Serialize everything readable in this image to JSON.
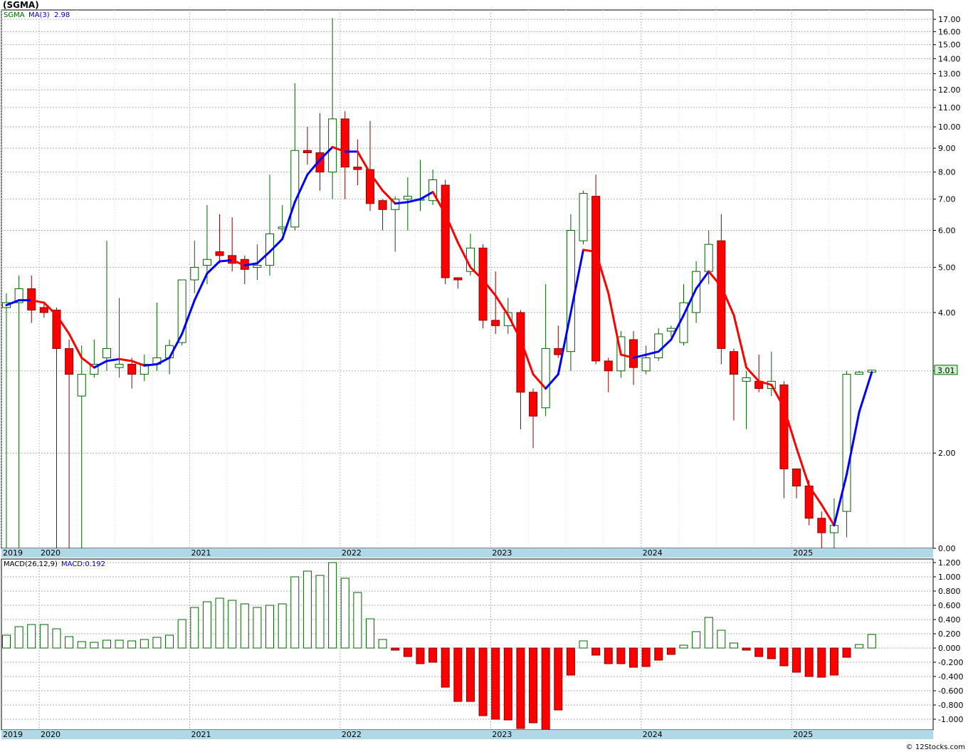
{
  "header": {
    "title": "(SGMA)"
  },
  "footer": {
    "credit": "© 12Stocks.com"
  },
  "colors": {
    "up": "#006400",
    "down": "#ff0000",
    "ma_up": "#0000ff",
    "ma_down": "#ff0000",
    "grid": "#b0b0b0",
    "year_band": "#b0d8e6",
    "hist_up": "#006400",
    "hist_down": "#ff0000",
    "macd_text": "#0000cc",
    "sym_text": "#006400"
  },
  "chart_data": [
    {
      "type": "candlestick",
      "legend": {
        "symbol": "SGMA",
        "ma_label": "MA(3)",
        "ma_value": "2.98"
      },
      "last_price_label": "3.01",
      "scale": "log",
      "ylim": [
        1.25,
        17.8
      ],
      "y_ticks": [
        "17.00",
        "16.00",
        "15.00",
        "14.00",
        "13.00",
        "12.00",
        "11.00",
        "10.00",
        "9.00",
        "8.00",
        "7.00",
        "6.00",
        "5.00",
        "4.00",
        "3.00",
        "2.00",
        "0.00"
      ],
      "year_labels": [
        {
          "label": "2019",
          "index": -0.3
        },
        {
          "label": "2020",
          "index": 3.0
        },
        {
          "label": "2021",
          "index": 15.0
        },
        {
          "label": "2022",
          "index": 27.0
        },
        {
          "label": "2023",
          "index": 39.0
        },
        {
          "label": "2024",
          "index": 51.0
        },
        {
          "label": "2025",
          "index": 63.0
        }
      ],
      "candles": [
        {
          "o": 4.1,
          "h": 4.4,
          "l": 1.25,
          "c": 4.2
        },
        {
          "o": 4.2,
          "h": 4.8,
          "l": 1.25,
          "c": 4.5
        },
        {
          "o": 4.5,
          "h": 4.8,
          "l": 3.8,
          "c": 4.05
        },
        {
          "o": 4.1,
          "h": 4.2,
          "l": 3.9,
          "c": 4.0
        },
        {
          "o": 4.05,
          "h": 4.1,
          "l": 1.25,
          "c": 3.35
        },
        {
          "o": 3.35,
          "h": 3.5,
          "l": 1.25,
          "c": 2.95
        },
        {
          "o": 2.65,
          "h": 3.4,
          "l": 1.25,
          "c": 2.95
        },
        {
          "o": 2.95,
          "h": 3.5,
          "l": 2.9,
          "c": 3.1
        },
        {
          "o": 3.2,
          "h": 5.7,
          "l": 3.0,
          "c": 3.35
        },
        {
          "o": 3.05,
          "h": 4.3,
          "l": 2.9,
          "c": 3.1
        },
        {
          "o": 3.1,
          "h": 3.2,
          "l": 2.75,
          "c": 2.95
        },
        {
          "o": 2.95,
          "h": 3.25,
          "l": 2.85,
          "c": 3.1
        },
        {
          "o": 3.1,
          "h": 4.2,
          "l": 3.0,
          "c": 3.2
        },
        {
          "o": 3.2,
          "h": 3.5,
          "l": 2.95,
          "c": 3.4
        },
        {
          "o": 3.45,
          "h": 4.7,
          "l": 3.4,
          "c": 4.7
        },
        {
          "o": 4.7,
          "h": 5.7,
          "l": 4.4,
          "c": 5.0
        },
        {
          "o": 5.05,
          "h": 6.8,
          "l": 4.6,
          "c": 5.2
        },
        {
          "o": 5.4,
          "h": 6.5,
          "l": 5.1,
          "c": 5.3
        },
        {
          "o": 5.3,
          "h": 6.4,
          "l": 4.9,
          "c": 5.1
        },
        {
          "o": 5.2,
          "h": 5.3,
          "l": 4.6,
          "c": 4.95
        },
        {
          "o": 5.0,
          "h": 5.6,
          "l": 4.7,
          "c": 5.05
        },
        {
          "o": 5.05,
          "h": 7.9,
          "l": 4.8,
          "c": 5.9
        },
        {
          "o": 6.05,
          "h": 6.8,
          "l": 5.9,
          "c": 6.1
        },
        {
          "o": 6.1,
          "h": 12.4,
          "l": 6.0,
          "c": 8.9
        },
        {
          "o": 8.9,
          "h": 10.0,
          "l": 8.3,
          "c": 8.8
        },
        {
          "o": 8.8,
          "h": 10.7,
          "l": 7.3,
          "c": 8.0
        },
        {
          "o": 8.0,
          "h": 17.1,
          "l": 7.0,
          "c": 10.4
        },
        {
          "o": 10.4,
          "h": 10.8,
          "l": 7.0,
          "c": 8.2
        },
        {
          "o": 8.2,
          "h": 9.4,
          "l": 7.5,
          "c": 8.1
        },
        {
          "o": 8.1,
          "h": 10.3,
          "l": 6.6,
          "c": 6.85
        },
        {
          "o": 6.95,
          "h": 7.0,
          "l": 6.0,
          "c": 6.65
        },
        {
          "o": 6.65,
          "h": 7.1,
          "l": 5.4,
          "c": 7.0
        },
        {
          "o": 7.0,
          "h": 7.8,
          "l": 6.0,
          "c": 7.1
        },
        {
          "o": 7.0,
          "h": 8.5,
          "l": 6.6,
          "c": 7.0
        },
        {
          "o": 6.95,
          "h": 8.1,
          "l": 6.8,
          "c": 7.7
        },
        {
          "o": 7.5,
          "h": 7.7,
          "l": 4.6,
          "c": 4.75
        },
        {
          "o": 4.75,
          "h": 4.75,
          "l": 4.5,
          "c": 4.7
        },
        {
          "o": 4.9,
          "h": 5.9,
          "l": 4.8,
          "c": 5.5
        },
        {
          "o": 5.5,
          "h": 5.6,
          "l": 3.7,
          "c": 3.85
        },
        {
          "o": 3.85,
          "h": 4.9,
          "l": 3.6,
          "c": 3.75
        },
        {
          "o": 3.75,
          "h": 4.3,
          "l": 3.6,
          "c": 4.0
        },
        {
          "o": 4.0,
          "h": 4.05,
          "l": 2.25,
          "c": 2.7
        },
        {
          "o": 2.7,
          "h": 2.75,
          "l": 2.05,
          "c": 2.4
        },
        {
          "o": 2.5,
          "h": 4.6,
          "l": 2.4,
          "c": 3.35
        },
        {
          "o": 3.35,
          "h": 3.75,
          "l": 3.2,
          "c": 3.25
        },
        {
          "o": 3.3,
          "h": 6.5,
          "l": 3.0,
          "c": 6.0
        },
        {
          "o": 5.7,
          "h": 7.3,
          "l": 5.6,
          "c": 7.2
        },
        {
          "o": 7.1,
          "h": 7.9,
          "l": 3.1,
          "c": 3.15
        },
        {
          "o": 3.15,
          "h": 3.2,
          "l": 2.7,
          "c": 3.0
        },
        {
          "o": 3.0,
          "h": 3.65,
          "l": 2.9,
          "c": 3.55
        },
        {
          "o": 3.5,
          "h": 3.65,
          "l": 2.8,
          "c": 3.05
        },
        {
          "o": 3.0,
          "h": 3.4,
          "l": 2.95,
          "c": 3.2
        },
        {
          "o": 3.2,
          "h": 3.7,
          "l": 3.15,
          "c": 3.6
        },
        {
          "o": 3.65,
          "h": 3.75,
          "l": 3.55,
          "c": 3.7
        },
        {
          "o": 3.45,
          "h": 4.6,
          "l": 3.4,
          "c": 4.2
        },
        {
          "o": 4.0,
          "h": 5.15,
          "l": 3.8,
          "c": 4.9
        },
        {
          "o": 4.9,
          "h": 6.0,
          "l": 4.6,
          "c": 5.6
        },
        {
          "o": 5.7,
          "h": 6.5,
          "l": 3.1,
          "c": 3.35
        },
        {
          "o": 3.3,
          "h": 3.35,
          "l": 2.35,
          "c": 2.95
        },
        {
          "o": 2.85,
          "h": 3.0,
          "l": 2.25,
          "c": 2.9
        },
        {
          "o": 2.85,
          "h": 3.25,
          "l": 2.7,
          "c": 2.75
        },
        {
          "o": 2.75,
          "h": 3.3,
          "l": 2.65,
          "c": 2.85
        },
        {
          "o": 2.8,
          "h": 2.85,
          "l": 1.6,
          "c": 1.85
        },
        {
          "o": 1.85,
          "h": 1.85,
          "l": 1.6,
          "c": 1.7
        },
        {
          "o": 1.7,
          "h": 1.75,
          "l": 1.4,
          "c": 1.45
        },
        {
          "o": 1.45,
          "h": 1.5,
          "l": 1.25,
          "c": 1.35
        },
        {
          "o": 1.35,
          "h": 1.6,
          "l": 1.25,
          "c": 1.4
        },
        {
          "o": 1.5,
          "h": 3.0,
          "l": 1.32,
          "c": 2.95
        },
        {
          "o": 2.95,
          "h": 3.0,
          "l": 2.95,
          "c": 2.98
        },
        {
          "o": 2.98,
          "h": 3.02,
          "l": 2.98,
          "c": 3.01
        }
      ],
      "ma": [
        4.15,
        4.25,
        4.25,
        4.2,
        3.95,
        3.6,
        3.2,
        3.05,
        3.15,
        3.18,
        3.15,
        3.08,
        3.1,
        3.2,
        3.6,
        4.25,
        4.85,
        5.15,
        5.18,
        5.05,
        5.1,
        5.4,
        5.75,
        6.9,
        7.9,
        8.5,
        9.05,
        8.85,
        8.85,
        7.95,
        7.3,
        6.85,
        6.9,
        7.0,
        7.25,
        6.5,
        5.65,
        5.0,
        4.7,
        4.35,
        3.95,
        3.5,
        2.95,
        2.75,
        2.95,
        4.0,
        5.45,
        5.4,
        4.4,
        3.25,
        3.2,
        3.25,
        3.3,
        3.5,
        3.95,
        4.5,
        4.9,
        4.55,
        3.95,
        3.05,
        2.85,
        2.8,
        2.5,
        2.05,
        1.7,
        1.55,
        1.4,
        1.8,
        2.45,
        2.98
      ],
      "macd": {
        "label": "MACD(26,12,9)",
        "value_label": "MACD:0.192",
        "ylim": [
          -1.15,
          1.25
        ],
        "y_ticks": [
          "1.200",
          "1.000",
          "0.800",
          "0.600",
          "0.400",
          "0.200",
          "0.000",
          "-0.200",
          "-0.400",
          "-0.600",
          "-0.800",
          "-1.000"
        ],
        "hist": [
          0.18,
          0.3,
          0.33,
          0.33,
          0.27,
          0.16,
          0.09,
          0.08,
          0.11,
          0.11,
          0.1,
          0.12,
          0.15,
          0.18,
          0.4,
          0.57,
          0.65,
          0.7,
          0.67,
          0.62,
          0.57,
          0.6,
          0.62,
          1.0,
          1.08,
          1.02,
          1.2,
          0.98,
          0.78,
          0.41,
          0.12,
          -0.03,
          -0.12,
          -0.22,
          -0.2,
          -0.55,
          -0.75,
          -0.75,
          -0.95,
          -1.0,
          -1.01,
          -1.13,
          -1.05,
          -1.22,
          -0.87,
          -0.38,
          0.1,
          -0.1,
          -0.22,
          -0.22,
          -0.27,
          -0.26,
          -0.17,
          -0.09,
          0.04,
          0.23,
          0.43,
          0.25,
          0.07,
          -0.03,
          -0.12,
          -0.15,
          -0.25,
          -0.34,
          -0.4,
          -0.41,
          -0.38,
          -0.13,
          0.05,
          0.19
        ]
      }
    }
  ]
}
